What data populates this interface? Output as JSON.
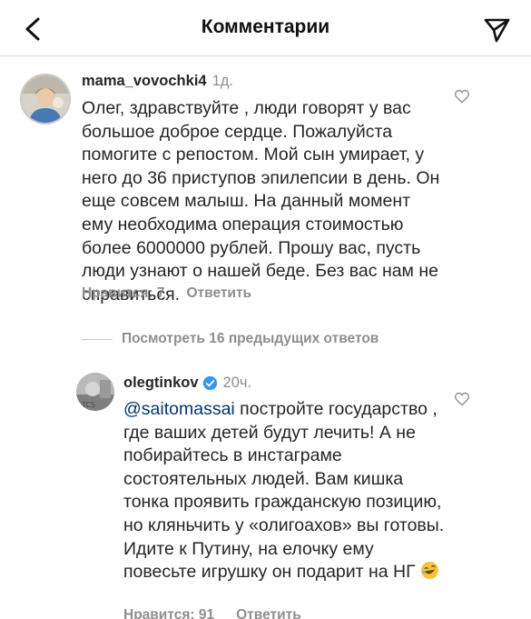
{
  "header": {
    "title": "Комментарии",
    "back_icon": "chevron-left-icon",
    "share_icon": "send-icon"
  },
  "comment1": {
    "username": "mama_vovochki4",
    "time": "1д.",
    "text": "Олег, здравствуйте , люди говорят у вас большое доброе сердце. Пожалуйста помогите с репостом. Мой сын умирает, у него до 36 приступов эпилепсии в день. Он еще совсем малыш. На данный момент ему необходима операция стоимостью более 6000000 рублей. Прошу вас, пусть люди узнают о нашей беде. Без вас нам не справиться.",
    "likes_label": "Нравится: 7",
    "reply_label": "Ответить"
  },
  "replies": {
    "label": "Посмотреть 16 предыдущих ответов"
  },
  "comment2": {
    "username": "olegtinkov",
    "time": "20ч.",
    "mention": "@saitomassai",
    "text": " постройте государство , где ваших детей будут лечить! А не побирайтесь в инстаграме состоятельных людей. Вам кишка тонка проявить гражданскую позицию, но кляньчить у «олигоахов» вы готовы. Идите к Путину, на елочку ему повесьте игрушку он подарит на НГ",
    "emoji": "rolling-on-floor-laughing-emoji",
    "likes_label": "Нравится: 91",
    "reply_label": "Ответить"
  },
  "colors": {
    "text": "#262626",
    "secondary": "#8e8e8e",
    "mention": "#00376b",
    "verified": "#3897f0"
  }
}
